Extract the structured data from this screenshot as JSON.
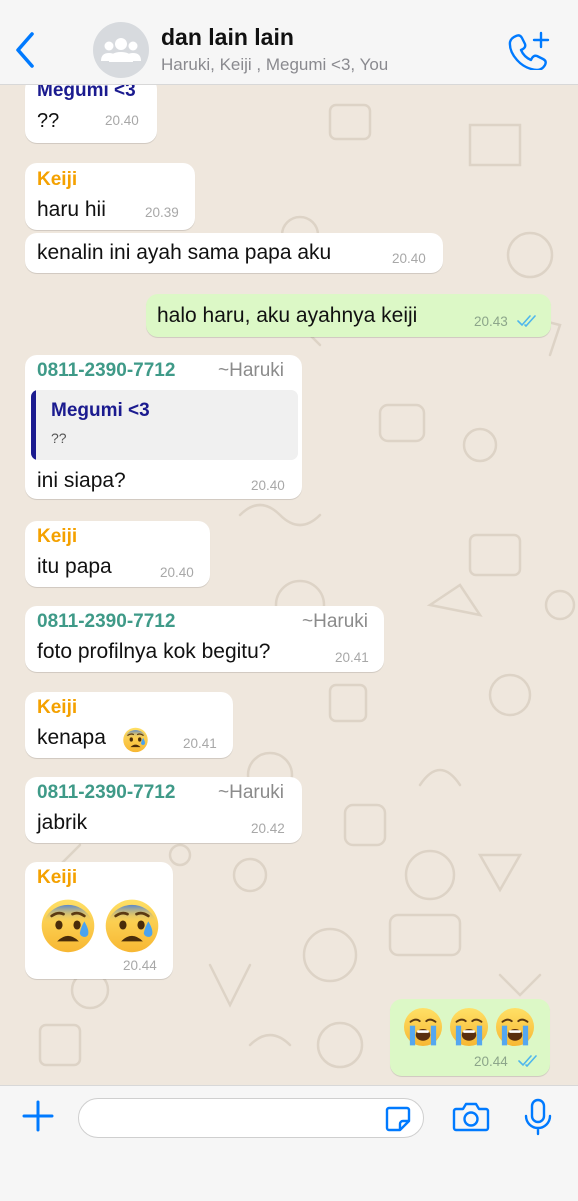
{
  "header": {
    "title": "dan lain lain",
    "subtitle": "Haruki, Keiji , Megumi <3, You",
    "back_icon": "chevron-left-icon",
    "avatar_icon": "group-icon",
    "call_icon": "add-call-icon"
  },
  "colors": {
    "accent": "#007aff",
    "incoming_bubble": "#ffffff",
    "outgoing_bubble": "#dcf8c6",
    "megumi_name": "#1b1b8f",
    "keiji_name": "#f4a100",
    "haruki_name": "#3f9a88",
    "read_ticks": "#4fb6ec"
  },
  "messages": [
    {
      "sender": "Megumi <3",
      "text": "??",
      "time": "20.40"
    },
    {
      "sender": "Keiji",
      "text": "haru hii",
      "time": "20.39"
    },
    {
      "text": "kenalin ini ayah sama papa aku",
      "time": "20.40"
    },
    {
      "text": "halo haru, aku ayahnya keiji",
      "time": "20.43"
    },
    {
      "sender": "0811-2390-7712",
      "sender_tag": "~Haruki",
      "quote": {
        "sender": "Megumi <3",
        "text": "??"
      },
      "text": "ini siapa?",
      "time": "20.40"
    },
    {
      "sender": "Keiji",
      "text": "itu papa",
      "time": "20.40"
    },
    {
      "sender": "0811-2390-7712",
      "sender_tag": "~Haruki",
      "text": "foto profilnya kok begitu?",
      "time": "20.41"
    },
    {
      "sender": "Keiji",
      "text": "kenapa",
      "emoji": "anxious-sweat-face-emoji",
      "time": "20.41"
    },
    {
      "sender": "0811-2390-7712",
      "sender_tag": "~Haruki",
      "text": "jabrik",
      "time": "20.42"
    },
    {
      "sender": "Keiji",
      "emojis": [
        "anxious-sweat-face-emoji",
        "anxious-sweat-face-emoji"
      ],
      "time": "20.44"
    },
    {
      "emojis": [
        "loudly-crying-face-emoji",
        "loudly-crying-face-emoji",
        "loudly-crying-face-emoji"
      ],
      "time": "20.44"
    }
  ],
  "input_bar": {
    "placeholder": "",
    "plus_icon": "plus-icon",
    "sticker_icon": "sticker-icon",
    "camera_icon": "camera-icon",
    "mic_icon": "microphone-icon"
  }
}
